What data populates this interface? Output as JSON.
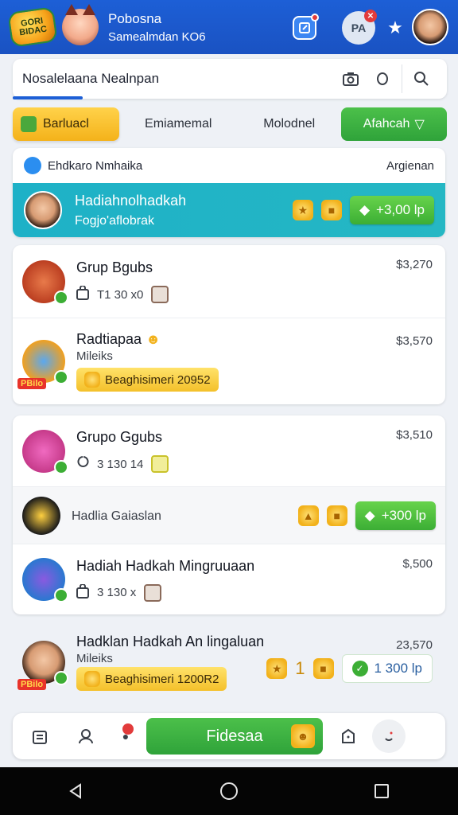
{
  "header": {
    "logo_text": "GORI BIDAC",
    "title": "Pobosna",
    "subtitle": "Samealmdan KO6",
    "chart_icon_label": "PA",
    "icons": [
      "edit-icon",
      "chart-icon",
      "star-icon",
      "avatar"
    ]
  },
  "search": {
    "value": "Nosalelaana Nealnpan",
    "icons": [
      "camera-icon",
      "circle-icon",
      "search-icon"
    ]
  },
  "tabs": {
    "active": "Barluacl",
    "tab2": "Emiamemal",
    "tab3": "Molodnel",
    "action": "Afahcah"
  },
  "card1": {
    "label": "Ehdkaro Nmhaika",
    "right_label": "Argienan",
    "banner_title": "Hadiahnolhadkah",
    "banner_subtitle": "Fogjo'aflobrak",
    "amount": "+3,00 lp"
  },
  "card2": {
    "rows": [
      {
        "title": "Grup Bgubs",
        "price": "$3,270",
        "meta": "T1 30 x0"
      },
      {
        "title": "Radtiapaa",
        "subtitle": "Mileiks",
        "price": "$3,570",
        "pill": "Beaghisimeri 20952",
        "badge": "PBilo"
      }
    ]
  },
  "card3": {
    "rows": [
      {
        "title": "Grupo Ggubs",
        "price": "$3,510",
        "meta": "3 130 14"
      },
      {
        "title": "Hadlia Gaiaslan",
        "amount": "+300 lp"
      },
      {
        "title": "Hadiah Hadkah Mingruuaan",
        "price": "$,500",
        "meta": "3 130 x"
      }
    ]
  },
  "card4": {
    "title": "Hadklan Hadkah An lingaluan",
    "subtitle": "Mileiks",
    "price": "23,570",
    "pill": "Beaghisimeri 1200R2",
    "amount": "1 300 lp",
    "badge": "PBilo",
    "num": "1"
  },
  "bottomnav": {
    "main_button": "Fidesaa",
    "icons": [
      "home-icon",
      "profile-icon",
      "gift-icon",
      "bag-icon",
      "settings-icon"
    ]
  },
  "system": [
    "back-icon",
    "home-circle-icon",
    "recents-icon"
  ]
}
